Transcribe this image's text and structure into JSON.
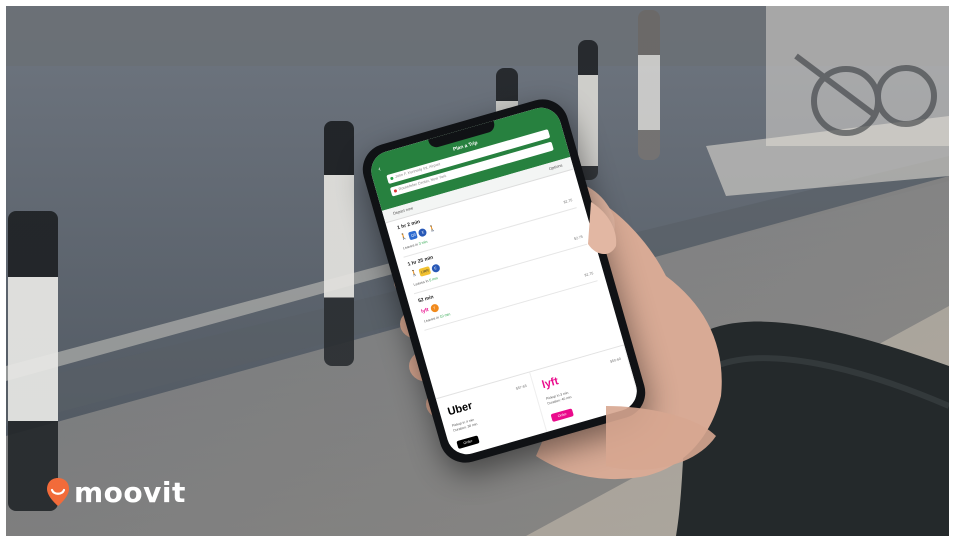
{
  "brand": {
    "name": "moovit",
    "pin_color": "#f26b3a"
  },
  "app": {
    "header_title": "Plan a Trip",
    "from_placeholder": "John F. Kennedy Int. Airport",
    "to_placeholder": "Rockefeller Center, New York",
    "depart_label": "Depart now",
    "options_label": "Options",
    "routes": [
      {
        "duration": "1 hr 2 min",
        "departs_text": "Leaves in",
        "departs_time": "3 min",
        "price": "$2.75"
      },
      {
        "duration": "1 hr 25 min",
        "departs_text": "Leaves in",
        "departs_time": "5 min",
        "price": "$2.75"
      },
      {
        "duration": "52 min",
        "departs_text": "Leaves in",
        "departs_time": "10 min",
        "price": "$2.75"
      }
    ],
    "rides": [
      {
        "name": "Uber",
        "price": "$57-65",
        "pickup": "Pickup in 4 min",
        "duration": "Duration: 38 min",
        "button": "Order",
        "color": "#000000"
      },
      {
        "name": "lyft",
        "price": "$50-60",
        "pickup": "Pickup in 3 min",
        "duration": "Duration: 40 min",
        "button": "Order",
        "color": "#ea0b8c"
      }
    ],
    "accent": "#27813f"
  }
}
